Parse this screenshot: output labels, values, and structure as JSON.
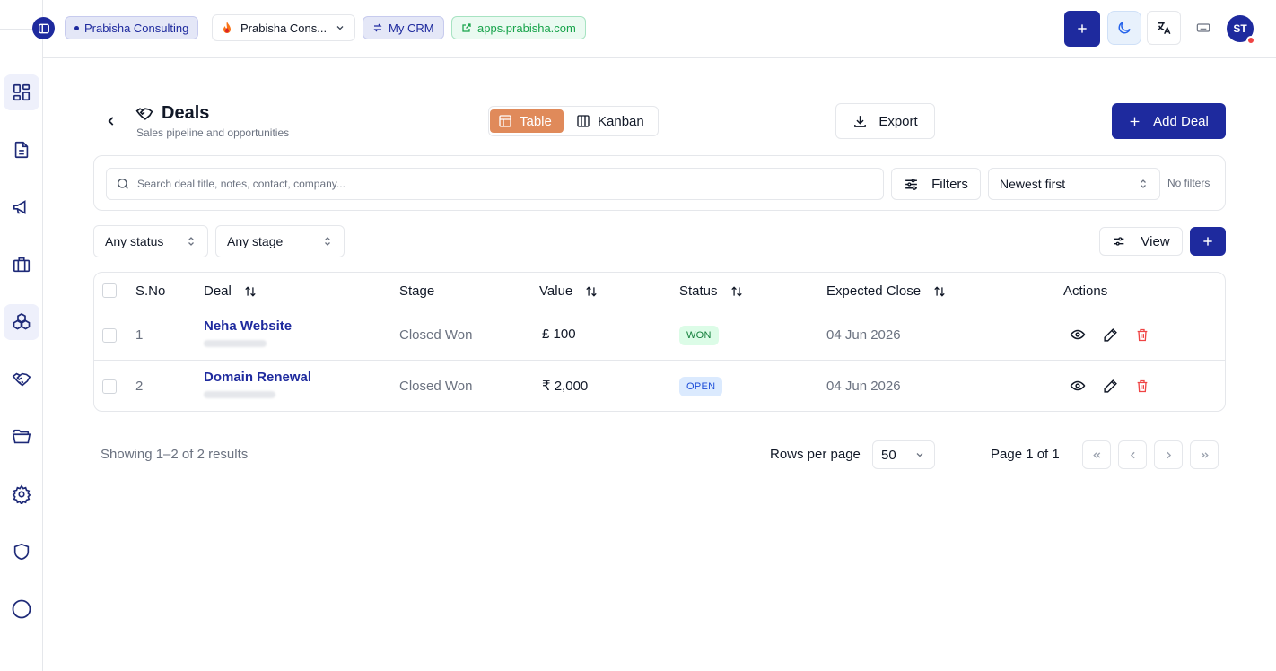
{
  "topbar": {
    "org_badge": "Prabisha Consulting",
    "org_select": "Prabisha Cons...",
    "crm_link": "My CRM",
    "app_url": "apps.prabisha.com",
    "avatar_initials": "ST"
  },
  "sidebar": {
    "items": [
      {
        "icon": "dashboard-icon",
        "active": true
      },
      {
        "icon": "document-icon",
        "active": false
      },
      {
        "icon": "megaphone-icon",
        "active": false
      },
      {
        "icon": "briefcase-icon",
        "active": false
      },
      {
        "icon": "boxes-icon",
        "active": true
      },
      {
        "icon": "handshake-icon",
        "active": false
      },
      {
        "icon": "folder-icon",
        "active": false
      },
      {
        "icon": "gear-icon",
        "active": false
      },
      {
        "icon": "shield-icon",
        "active": false
      },
      {
        "icon": "circle-icon",
        "active": false
      }
    ]
  },
  "page": {
    "title": "Deals",
    "subtitle": "Sales pipeline and opportunities",
    "view_table": "Table",
    "view_kanban": "Kanban",
    "export_label": "Export",
    "add_deal_label": "Add Deal"
  },
  "filters": {
    "search_placeholder": "Search deal title, notes, contact, company...",
    "filters_label": "Filters",
    "sort_value": "Newest first",
    "no_filters": "No filters",
    "status_select": "Any status",
    "stage_select": "Any stage",
    "view_label": "View"
  },
  "table": {
    "columns": [
      "S.No",
      "Deal",
      "Stage",
      "Value",
      "Status",
      "Expected Close",
      "Actions"
    ],
    "rows": [
      {
        "sno": "1",
        "deal": "Neha Website",
        "stage": "Closed Won",
        "value": "£ 100",
        "status": "WON",
        "expected_close": "04 Jun 2026"
      },
      {
        "sno": "2",
        "deal": "Domain Renewal",
        "stage": "Closed Won",
        "value": "₹ 2,000",
        "status": "OPEN",
        "expected_close": "04 Jun 2026"
      }
    ]
  },
  "pagination": {
    "showing": "Showing 1–2 of 2 results",
    "rows_per_page_label": "Rows per page",
    "rows_per_page_value": "50",
    "page_info": "Page 1 of 1"
  },
  "colors": {
    "primary": "#1e2a9e",
    "table_toggle_active": "#e08a5a",
    "won_badge_bg": "#dcfce7",
    "open_badge_bg": "#dbeafe",
    "delete_red": "#ef4444"
  }
}
